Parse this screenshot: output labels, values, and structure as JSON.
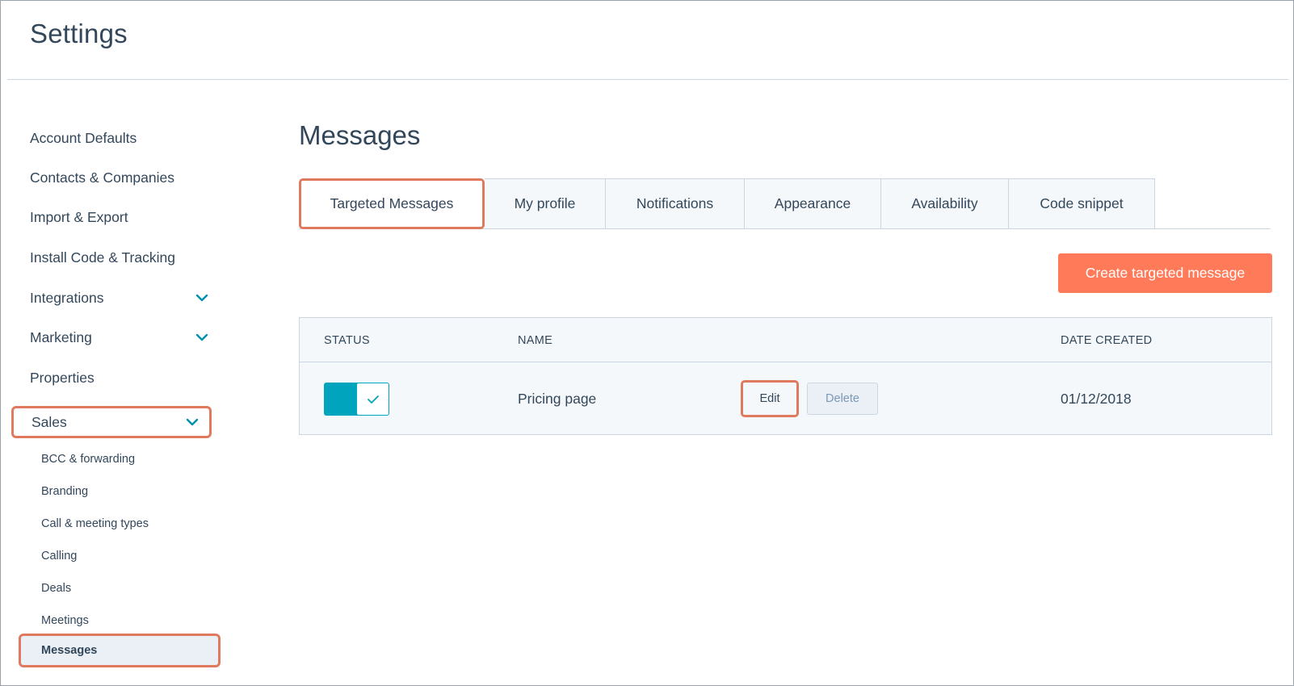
{
  "app": {
    "title": "Settings"
  },
  "sidebar": {
    "items": [
      {
        "label": "Account Defaults",
        "expandable": false
      },
      {
        "label": "Contacts & Companies",
        "expandable": false
      },
      {
        "label": "Import & Export",
        "expandable": false
      },
      {
        "label": "Install Code & Tracking",
        "expandable": false
      },
      {
        "label": "Integrations",
        "expandable": true
      },
      {
        "label": "Marketing",
        "expandable": true
      },
      {
        "label": "Properties",
        "expandable": false
      },
      {
        "label": "Sales",
        "expandable": true,
        "expanded": true
      }
    ],
    "sales_subitems": [
      {
        "label": "BCC & forwarding"
      },
      {
        "label": "Branding"
      },
      {
        "label": "Call & meeting types"
      },
      {
        "label": "Calling"
      },
      {
        "label": "Deals"
      },
      {
        "label": "Meetings"
      },
      {
        "label": "Messages",
        "active": true
      }
    ],
    "icons": {
      "expand": "chevron-down-icon"
    }
  },
  "main": {
    "title": "Messages",
    "tabs": [
      {
        "label": "Targeted Messages",
        "active": true
      },
      {
        "label": "My profile"
      },
      {
        "label": "Notifications"
      },
      {
        "label": "Appearance"
      },
      {
        "label": "Availability"
      },
      {
        "label": "Code snippet"
      }
    ],
    "create_button": "Create targeted message",
    "table": {
      "headers": {
        "status": "STATUS",
        "name": "NAME",
        "date": "DATE CREATED"
      },
      "rows": [
        {
          "status_on": true,
          "name": "Pricing page",
          "edit_label": "Edit",
          "delete_label": "Delete",
          "date": "01/12/2018"
        }
      ]
    }
  },
  "colors": {
    "text": "#33475b",
    "accent_orange": "#ff7a59",
    "highlight_border": "#e07a5f",
    "toggle_on": "#00a4bd",
    "chevron": "#0091ae",
    "border": "#cbd6e2",
    "panel_bg": "#f5f8fa"
  }
}
